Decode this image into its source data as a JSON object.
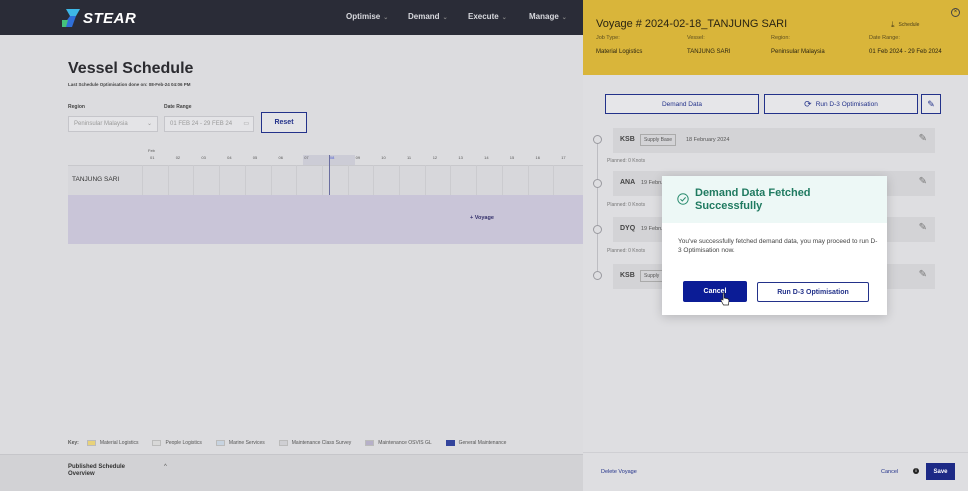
{
  "app": {
    "logo_text": "STEAR"
  },
  "nav": {
    "items": [
      {
        "label": "Optimise"
      },
      {
        "label": "Demand"
      },
      {
        "label": "Execute"
      },
      {
        "label": "Manage"
      }
    ]
  },
  "schedule": {
    "title": "Vessel Schedule",
    "last_optimised": "Last Schedule Optimisation done on: 08-Feb-24 04:06 PM",
    "region_label": "Region",
    "region_value": "Peninsular Malaysia",
    "date_range_label": "Date Range",
    "date_range_value": "01 FEB 24 - 29 FEB 24",
    "reset_label": "Reset",
    "month_label": "Feb",
    "days": [
      "01",
      "02",
      "03",
      "04",
      "05",
      "06",
      "07",
      "08",
      "09",
      "10",
      "11",
      "12",
      "13",
      "14",
      "15",
      "16",
      "17"
    ],
    "highlight_day": "08",
    "vessel_row": "TANJUNG SARI",
    "add_voyage": "+ Voyage"
  },
  "key": {
    "label": "Key:",
    "items": [
      {
        "label": "Material Logistics",
        "color": "#e8d27a"
      },
      {
        "label": "People Logistics",
        "color": "#d8d8d8"
      },
      {
        "label": "Marine Services",
        "color": "#c7d3e0"
      },
      {
        "label": "Maintenance Class Survey",
        "color": "#cfcfd3"
      },
      {
        "label": "Maintenance OSVIS GL",
        "color": "#b6b0c8"
      },
      {
        "label": "General Maintenance",
        "color": "#33449c"
      }
    ]
  },
  "published": {
    "title": "Published Schedule Overview",
    "chevron": "^"
  },
  "panel": {
    "title": "Voyage # 2024-02-18_TANJUNG SARI",
    "schedule_link": "Schedule",
    "meta": [
      {
        "label": "Job Type:",
        "value": "Material Logistics"
      },
      {
        "label": "Vessel:",
        "value": "TANJUNG SARI"
      },
      {
        "label": "Region:",
        "value": "Peninsular Malaysia"
      },
      {
        "label": "Date Range:",
        "value": "01 Feb 2024 - 29 Feb 2024"
      }
    ],
    "demand_btn": "Demand Data",
    "run_btn": "Run D-3 Optimisation",
    "stops": [
      {
        "code": "KSB",
        "tag": "Supply Base",
        "date": "18 February 2024",
        "planned": "Planned: 0 Knots"
      },
      {
        "code": "ANA",
        "tag": "",
        "date": "19 Febru",
        "planned": "Planned: 0 Knots"
      },
      {
        "code": "DYQ",
        "tag": "",
        "date": "19 Febru",
        "planned": "Planned: 0 Knots"
      },
      {
        "code": "KSB",
        "tag": "Supply",
        "date": "",
        "planned": ""
      }
    ],
    "delete_label": "Delete Voyage",
    "cancel_label": "Cancel",
    "save_label": "Save"
  },
  "modal": {
    "title": "Demand Data Fetched Successfully",
    "body": "You've successfully fetched demand data, you may proceed to run D-3 Optimisation now.",
    "cancel_label": "Cancel",
    "run_label": "Run D-3 Optimisation"
  }
}
